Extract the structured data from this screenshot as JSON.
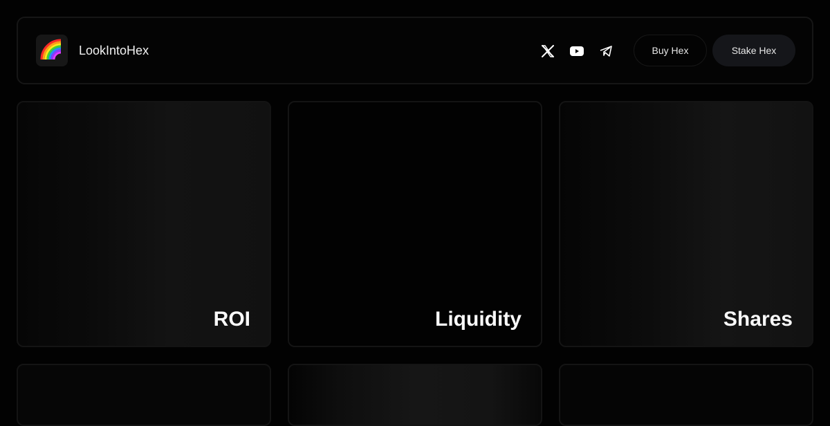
{
  "header": {
    "brand_name": "LookIntoHex",
    "social_icons": [
      "x-twitter-icon",
      "youtube-icon",
      "telegram-icon"
    ],
    "buy_label": "Buy Hex",
    "stake_label": "Stake Hex"
  },
  "cards": [
    {
      "label": "ROI"
    },
    {
      "label": "Liquidity"
    },
    {
      "label": "Shares"
    },
    {
      "label": ""
    },
    {
      "label": ""
    },
    {
      "label": ""
    }
  ],
  "colors": {
    "background": "#020202",
    "card_border": "#141414",
    "stake_button_bg": "#15161a",
    "text": "#ffffff"
  }
}
